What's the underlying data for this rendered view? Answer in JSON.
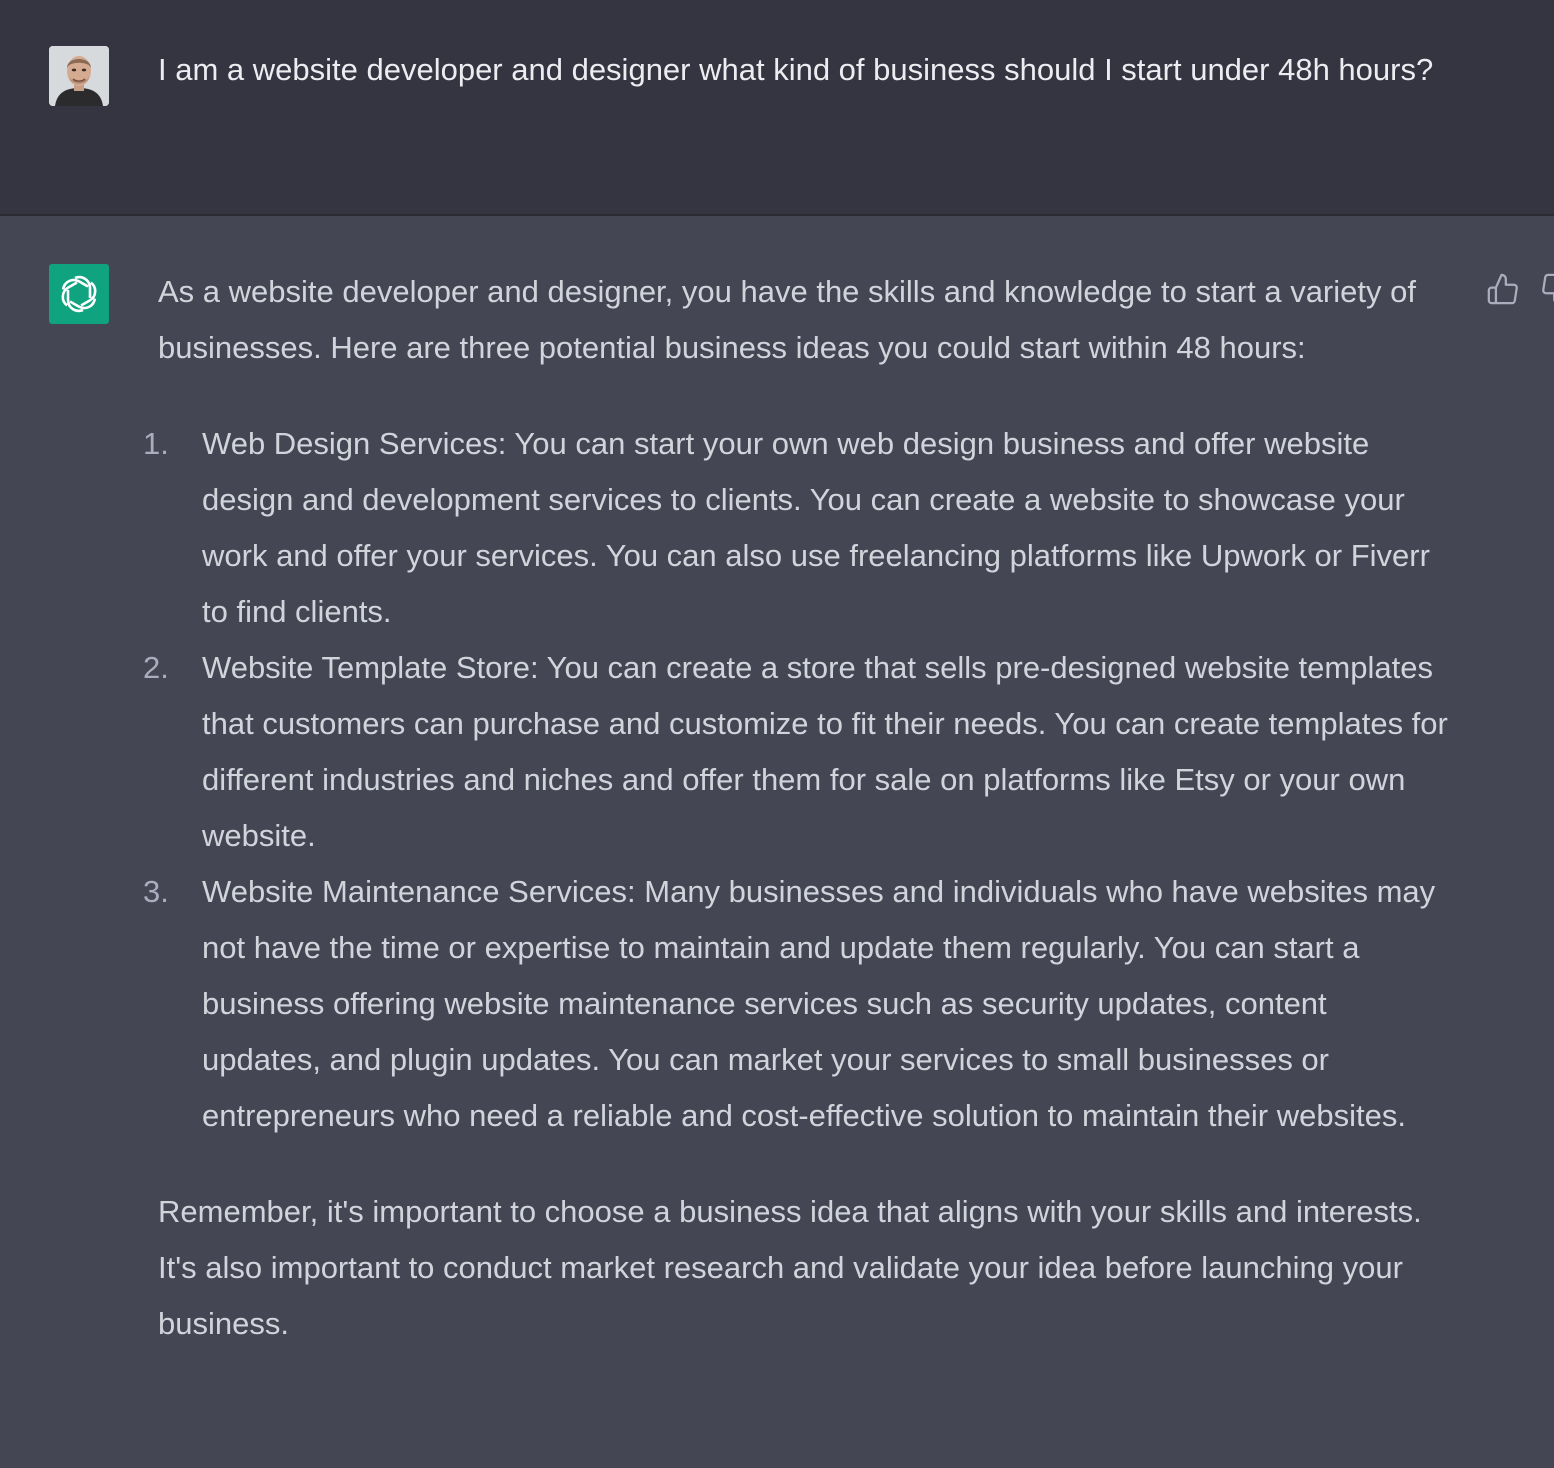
{
  "user_message": {
    "avatar_icon": "user-photo-avatar",
    "text": "I am a website developer and designer what kind of business should I start under 48h hours?"
  },
  "assistant_message": {
    "avatar_icon": "openai-logo-icon",
    "intro": "As a website developer and designer, you have the skills and knowledge to start a variety of businesses. Here are three potential business ideas you could start within 48 hours:",
    "items": [
      {
        "number": "1.",
        "text": "Web Design Services: You can start your own web design business and offer website design and development services to clients. You can create a website to showcase your work and offer your services. You can also use freelancing platforms like Upwork or Fiverr to find clients."
      },
      {
        "number": "2.",
        "text": "Website Template Store: You can create a store that sells pre-designed website templates that customers can purchase and customize to fit their needs. You can create templates for different industries and niches and offer them for sale on platforms like Etsy or your own website."
      },
      {
        "number": "3.",
        "text": "Website Maintenance Services: Many businesses and individuals who have websites may not have the time or expertise to maintain and update them regularly. You can start a business offering website maintenance services such as security updates, content updates, and plugin updates. You can market your services to small businesses or entrepreneurs who need a reliable and cost-effective solution to maintain their websites."
      }
    ],
    "closing": "Remember, it's important to choose a business idea that aligns with your skills and interests. It's also important to conduct market research and validate your idea before launching your business."
  },
  "colors": {
    "user_bg": "#343541",
    "assistant_bg": "#444654",
    "brand_green": "#10a37f"
  }
}
